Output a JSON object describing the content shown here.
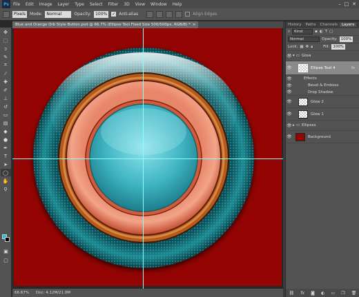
{
  "app": {
    "logo": "Ps"
  },
  "menu": [
    "File",
    "Edit",
    "Image",
    "Layer",
    "Type",
    "Select",
    "Filter",
    "3D",
    "View",
    "Window",
    "Help"
  ],
  "window_controls": [
    "–",
    "□",
    "✕"
  ],
  "options": {
    "units": "Pixels",
    "mode_label": "Mode:",
    "mode": "Normal",
    "opacity_label": "Opacity:",
    "opacity": "100%",
    "antialias": "Anti-alias",
    "align_edges": "Align Edges"
  },
  "document": {
    "tab_title": "Blue and Orange Orb Style Button.psd @ 66.7% (Ellipse Tool Fixed Size 500/500px, RGB/8) *",
    "close": "×"
  },
  "status": {
    "zoom": "66.67%",
    "doc": "Doc: 4.12M/21.0M"
  },
  "panel": {
    "tabs": [
      "History",
      "Paths",
      "Channels",
      "Layers"
    ],
    "kind": "Kind",
    "blend": "Normal",
    "opacity_label": "Opacity:",
    "opacity": "100%",
    "lock_label": "Lock:",
    "fill_label": "Fill:",
    "fill": "100%",
    "layers": [
      {
        "name": "Glow",
        "type": "group-open"
      },
      {
        "name": "Ellipse Tool 4",
        "type": "shape",
        "fx": "fx"
      },
      {
        "name": "Effects",
        "type": "effects"
      },
      {
        "name": "Bevel & Emboss",
        "type": "effect"
      },
      {
        "name": "Drop Shadow",
        "type": "effect"
      },
      {
        "name": "Glow 2",
        "type": "pixel"
      },
      {
        "name": "Glow 1",
        "type": "pixel"
      },
      {
        "name": "Ellipses",
        "type": "group"
      },
      {
        "name": "Background",
        "type": "background"
      }
    ]
  },
  "colors": {
    "canvas": "#930402",
    "foreground": "#1ec6d6",
    "background": "#000000"
  }
}
